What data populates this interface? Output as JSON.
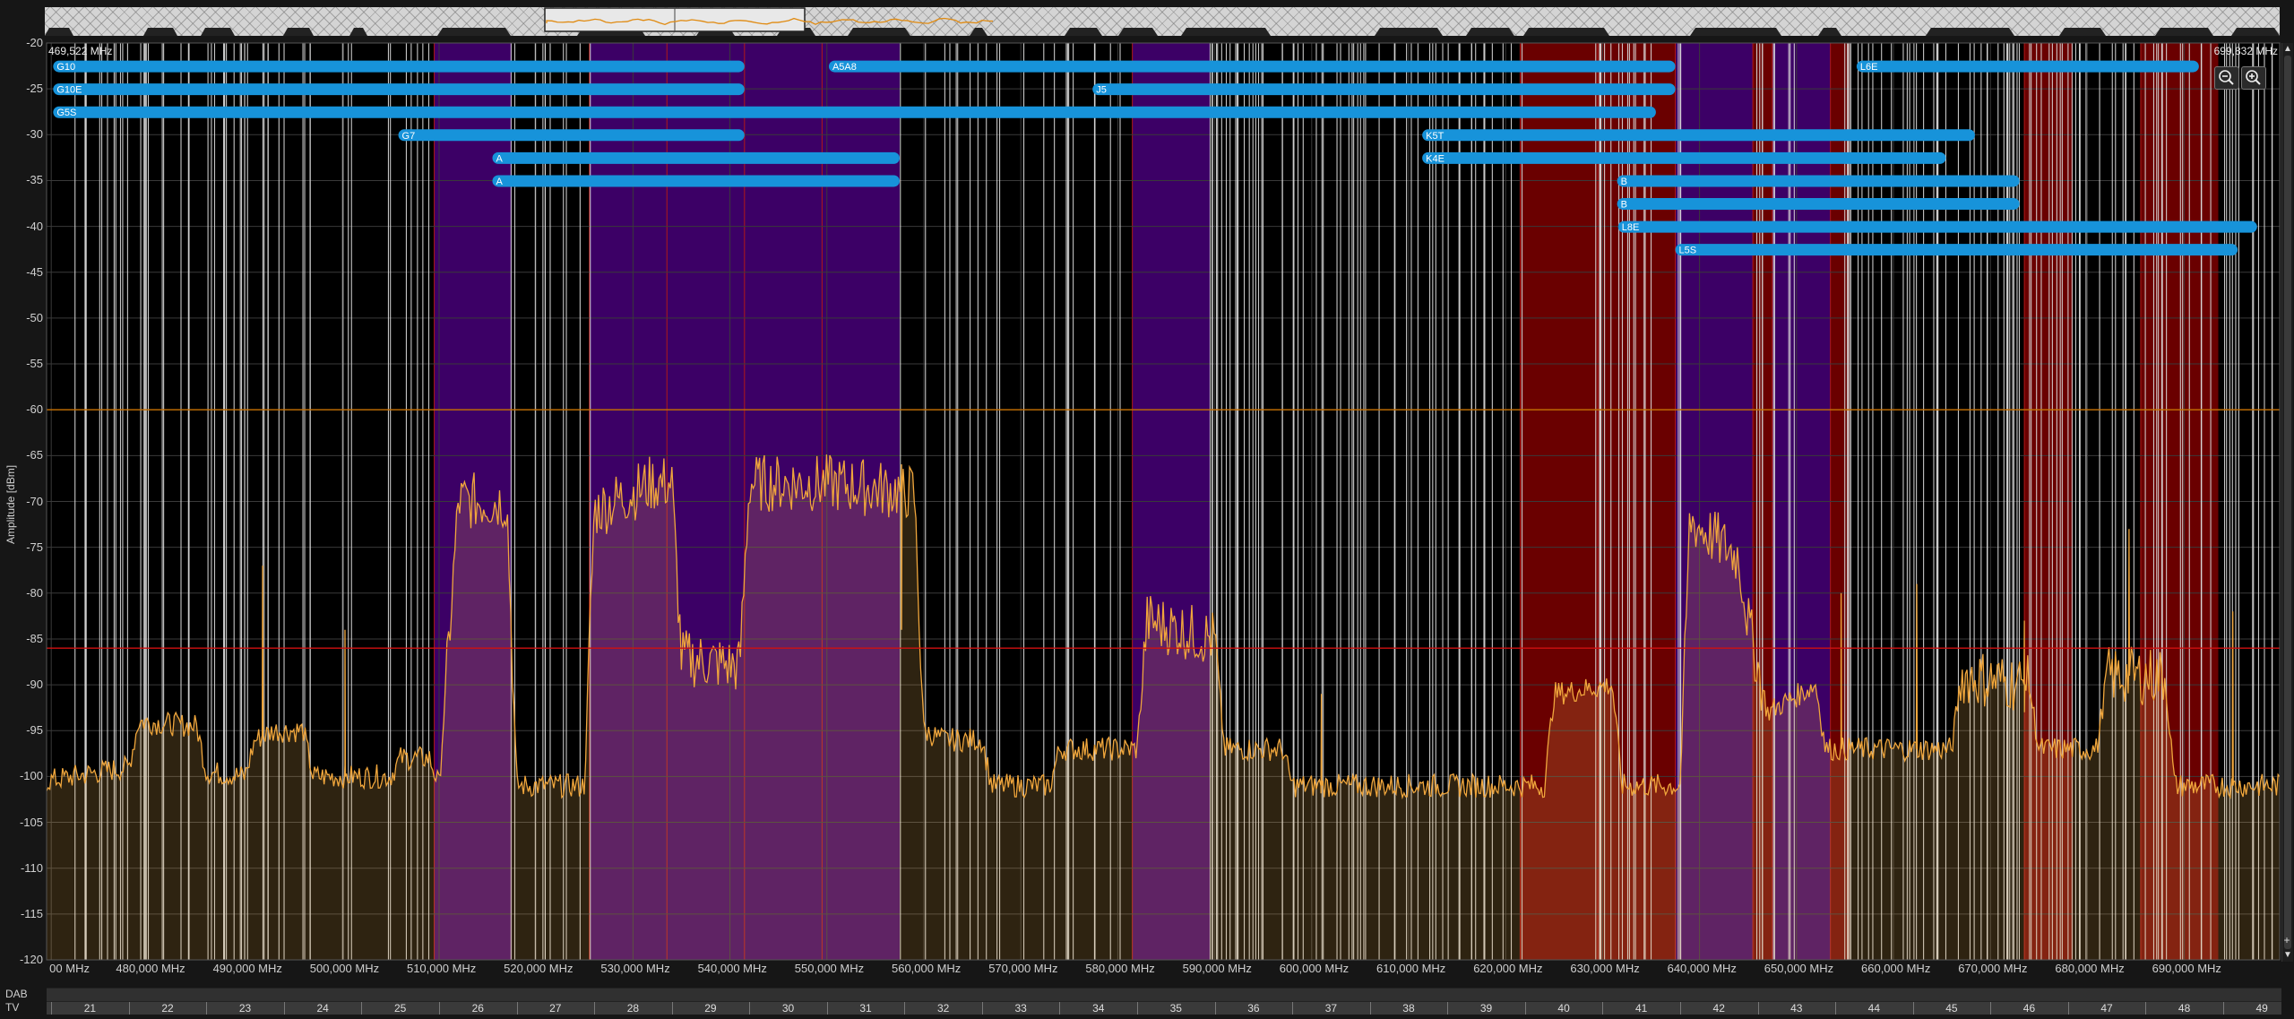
{
  "panel": {
    "start_freq": "469,522 MHz",
    "end_freq": "699,832 MHz",
    "y_axis_label": "Amplitude [dBm]",
    "zoom_out_icon": "zoom-out-icon",
    "zoom_in_icon": "zoom-in-icon",
    "scroll_up_icon": "triangle-up-icon",
    "scroll_down_icon": "triangle-down-icon",
    "scroll_add_icon": "plus-icon"
  },
  "bands": {
    "dab_label": "DAB",
    "tv_label": "TV",
    "tv_channels": [
      {
        "ch": "21",
        "mhz": 474
      },
      {
        "ch": "22",
        "mhz": 482
      },
      {
        "ch": "23",
        "mhz": 490
      },
      {
        "ch": "24",
        "mhz": 498
      },
      {
        "ch": "25",
        "mhz": 506
      },
      {
        "ch": "26",
        "mhz": 514
      },
      {
        "ch": "27",
        "mhz": 522
      },
      {
        "ch": "28",
        "mhz": 530
      },
      {
        "ch": "29",
        "mhz": 538
      },
      {
        "ch": "30",
        "mhz": 546
      },
      {
        "ch": "31",
        "mhz": 554
      },
      {
        "ch": "32",
        "mhz": 562
      },
      {
        "ch": "33",
        "mhz": 570
      },
      {
        "ch": "34",
        "mhz": 578
      },
      {
        "ch": "35",
        "mhz": 586
      },
      {
        "ch": "36",
        "mhz": 594
      },
      {
        "ch": "37",
        "mhz": 602
      },
      {
        "ch": "38",
        "mhz": 610
      },
      {
        "ch": "39",
        "mhz": 618
      },
      {
        "ch": "40",
        "mhz": 626
      },
      {
        "ch": "41",
        "mhz": 634
      },
      {
        "ch": "42",
        "mhz": 642
      },
      {
        "ch": "43",
        "mhz": 650
      },
      {
        "ch": "44",
        "mhz": 658
      },
      {
        "ch": "45",
        "mhz": 666
      },
      {
        "ch": "46",
        "mhz": 674
      },
      {
        "ch": "47",
        "mhz": 682
      },
      {
        "ch": "48",
        "mhz": 690
      },
      {
        "ch": "49",
        "mhz": 698
      }
    ]
  },
  "colors": {
    "plot_bg": "#000000",
    "trace": "#f0a63c",
    "trace_fill": "#3a2a10",
    "violet_block": "#3c0066",
    "red_block": "#6a0000",
    "threshold_orange": "#c87000",
    "threshold_red": "#d01010",
    "bar": "#1793da",
    "grid": "#3a3a3a",
    "carrier": "#dcdcdc"
  },
  "chart_data": {
    "type": "area",
    "xlabel": "",
    "ylabel": "Amplitude [dBm]",
    "xlim": [
      469.522,
      699.832
    ],
    "ylim": [
      -120,
      -20
    ],
    "grid": true,
    "x_ticks": [
      {
        "mhz": 470,
        "label": "00 MHz"
      },
      {
        "mhz": 480,
        "label": "480,000 MHz"
      },
      {
        "mhz": 490,
        "label": "490,000 MHz"
      },
      {
        "mhz": 500,
        "label": "500,000 MHz"
      },
      {
        "mhz": 510,
        "label": "510,000 MHz"
      },
      {
        "mhz": 520,
        "label": "520,000 MHz"
      },
      {
        "mhz": 530,
        "label": "530,000 MHz"
      },
      {
        "mhz": 540,
        "label": "540,000 MHz"
      },
      {
        "mhz": 550,
        "label": "550,000 MHz"
      },
      {
        "mhz": 560,
        "label": "560,000 MHz"
      },
      {
        "mhz": 570,
        "label": "570,000 MHz"
      },
      {
        "mhz": 580,
        "label": "580,000 MHz"
      },
      {
        "mhz": 590,
        "label": "590,000 MHz"
      },
      {
        "mhz": 600,
        "label": "600,000 MHz"
      },
      {
        "mhz": 610,
        "label": "610,000 MHz"
      },
      {
        "mhz": 620,
        "label": "620,000 MHz"
      },
      {
        "mhz": 630,
        "label": "630,000 MHz"
      },
      {
        "mhz": 640,
        "label": "640,000 MHz"
      },
      {
        "mhz": 650,
        "label": "650,000 MHz"
      },
      {
        "mhz": 660,
        "label": "660,000 MHz"
      },
      {
        "mhz": 670,
        "label": "670,000 MHz"
      },
      {
        "mhz": 680,
        "label": "680,000 MHz"
      },
      {
        "mhz": 690,
        "label": "690,000 MHz"
      }
    ],
    "y_ticks": [
      "-20",
      "-25",
      "-30",
      "-35",
      "-40",
      "-45",
      "-50",
      "-55",
      "-60",
      "-65",
      "-70",
      "-75",
      "-80",
      "-85",
      "-90",
      "-95",
      "-100",
      "-105",
      "-110",
      "-115",
      "-120"
    ],
    "y_tick_values": [
      -20,
      -25,
      -30,
      -35,
      -40,
      -45,
      -50,
      -55,
      -60,
      -65,
      -70,
      -75,
      -80,
      -85,
      -90,
      -95,
      -100,
      -105,
      -110,
      -115,
      -120
    ],
    "thresholds": [
      {
        "level": -60,
        "kind": "orange"
      },
      {
        "level": -86,
        "kind": "red"
      }
    ],
    "spectrum_profile": [
      [
        469.5,
        -100.5
      ],
      [
        475,
        -99.5
      ],
      [
        478,
        -99
      ],
      [
        479,
        -94
      ],
      [
        485,
        -94.5
      ],
      [
        486,
        -99.5
      ],
      [
        490,
        -100
      ],
      [
        491,
        -96
      ],
      [
        493,
        -95
      ],
      [
        496,
        -95
      ],
      [
        497,
        -100
      ],
      [
        505,
        -100
      ],
      [
        506,
        -98
      ],
      [
        509,
        -98
      ],
      [
        510,
        -101
      ],
      [
        512,
        -70
      ],
      [
        517,
        -70
      ],
      [
        518,
        -101
      ],
      [
        525,
        -101
      ],
      [
        526,
        -71
      ],
      [
        532,
        -68
      ],
      [
        534,
        -68
      ],
      [
        535,
        -87
      ],
      [
        541,
        -88
      ],
      [
        542,
        -68
      ],
      [
        550,
        -68
      ],
      [
        559,
        -69
      ],
      [
        560,
        -95
      ],
      [
        562,
        -96
      ],
      [
        566,
        -96
      ],
      [
        567,
        -101
      ],
      [
        573,
        -101
      ],
      [
        574,
        -97
      ],
      [
        582,
        -97
      ],
      [
        583,
        -83
      ],
      [
        590,
        -85
      ],
      [
        591,
        -97
      ],
      [
        597,
        -97
      ],
      [
        598,
        -101
      ],
      [
        624,
        -101
      ],
      [
        625,
        -91
      ],
      [
        631,
        -90
      ],
      [
        632,
        -101
      ],
      [
        638,
        -101
      ],
      [
        639,
        -72
      ],
      [
        644,
        -76
      ],
      [
        645,
        -83
      ],
      [
        647,
        -93
      ],
      [
        652,
        -90
      ],
      [
        653,
        -97
      ],
      [
        660,
        -97
      ],
      [
        661,
        -97
      ],
      [
        666,
        -97
      ],
      [
        667,
        -89
      ],
      [
        674,
        -90
      ],
      [
        675,
        -97
      ],
      [
        681,
        -97
      ],
      [
        682,
        -89
      ],
      [
        688,
        -89
      ],
      [
        689,
        -101
      ],
      [
        699.8,
        -101
      ]
    ],
    "spurs": [
      [
        491.8,
        -77
      ],
      [
        500.3,
        -84
      ],
      [
        557.7,
        -84
      ],
      [
        601,
        -91
      ],
      [
        654.6,
        -80
      ],
      [
        662.4,
        -79
      ],
      [
        673.5,
        -83
      ],
      [
        684.3,
        -73
      ],
      [
        695.0,
        -82
      ]
    ],
    "violet_blocks": [
      [
        509.5,
        517.5
      ],
      [
        525.5,
        533.5
      ],
      [
        533.5,
        541.5
      ],
      [
        541.5,
        549.5
      ],
      [
        549.5,
        557.5
      ],
      [
        581.5,
        589.5
      ],
      [
        637.5,
        645.5
      ],
      [
        647.5,
        653.5
      ]
    ],
    "red_blocks": [
      [
        621.5,
        629.5
      ],
      [
        629.5,
        637.5
      ],
      [
        645.5,
        647.5
      ],
      [
        653.5,
        655.5
      ],
      [
        673.5,
        678.5
      ],
      [
        685.5,
        693.5
      ]
    ],
    "bars": [
      {
        "label": "G10",
        "start": 470.2,
        "end": 541.5,
        "level": -22.5
      },
      {
        "label": "A5A8",
        "start": 550.2,
        "end": 637.5,
        "level": -22.5
      },
      {
        "label": "L6E",
        "start": 656.2,
        "end": 691.5,
        "level": -22.5
      },
      {
        "label": "G10E",
        "start": 470.2,
        "end": 541.5,
        "level": -25
      },
      {
        "label": "J5",
        "start": 577.4,
        "end": 637.5,
        "level": -25
      },
      {
        "label": "G5S",
        "start": 470.2,
        "end": 635.5,
        "level": -27.5
      },
      {
        "label": "G7",
        "start": 505.8,
        "end": 541.5,
        "level": -30
      },
      {
        "label": "K5T",
        "start": 611.4,
        "end": 668.4,
        "level": -30
      },
      {
        "label": "A",
        "start": 515.5,
        "end": 557.5,
        "level": -32.5
      },
      {
        "label": "K4E",
        "start": 611.4,
        "end": 665.4,
        "level": -32.5
      },
      {
        "label": "A",
        "start": 515.5,
        "end": 557.5,
        "level": -35
      },
      {
        "label": "B",
        "start": 631.5,
        "end": 673,
        "level": -35
      },
      {
        "label": "B",
        "start": 631.5,
        "end": 673,
        "level": -37.5
      },
      {
        "label": "L8E",
        "start": 631.6,
        "end": 697.5,
        "level": -40
      },
      {
        "label": "L5S",
        "start": 637.5,
        "end": 695.5,
        "level": -42.5
      }
    ]
  }
}
